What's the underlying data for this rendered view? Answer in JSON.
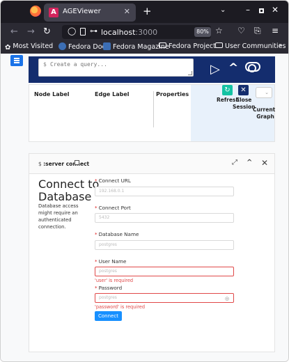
{
  "browser": {
    "tab_title": "AGEViewer",
    "tab_favicon": "age-viewer-favicon",
    "url_host": "localhost",
    "url_port": ":3000",
    "zoom": "80%",
    "bookmarks": [
      {
        "label": "Most Visited",
        "icon": "gear-icon"
      },
      {
        "label": "Fedora Docs",
        "icon": "fedora-icon"
      },
      {
        "label": "Fedora Magazine",
        "icon": "fm-icon"
      },
      {
        "label": "Fedora Project",
        "icon": "folder-icon"
      },
      {
        "label": "User Communities",
        "icon": "folder-icon"
      }
    ]
  },
  "editor": {
    "prompt": "$",
    "placeholder": "Create a query..."
  },
  "metadata": {
    "node_label": "Node Label",
    "edge_label": "Edge Label",
    "properties": "Properties",
    "refresh": "Refresh",
    "close_session_1": "Close",
    "close_session_2": "Session",
    "current_graph_1": "Current",
    "current_graph_2": "Graph"
  },
  "frame": {
    "command_prefix": "$",
    "command": ":server connect",
    "title_line1": "Connect to",
    "title_line2": "Database",
    "description": "Database access might require an authenticated connection.",
    "fields": [
      {
        "label": "Connect URL",
        "placeholder": "192.168.0.1",
        "error": ""
      },
      {
        "label": "Connect Port",
        "placeholder": "5432",
        "error": ""
      },
      {
        "label": "Database Name",
        "placeholder": "postgres",
        "error": ""
      },
      {
        "label": "User Name",
        "placeholder": "postgres",
        "error": "'user' is required"
      },
      {
        "label": "Password",
        "placeholder": "postgres",
        "error": "'password' is required"
      }
    ],
    "connect_button": "Connect"
  },
  "colors": {
    "editor_bar": "#142d6e",
    "refresh": "#14c2a3",
    "primary": "#1890ff",
    "error": "#e04848"
  }
}
